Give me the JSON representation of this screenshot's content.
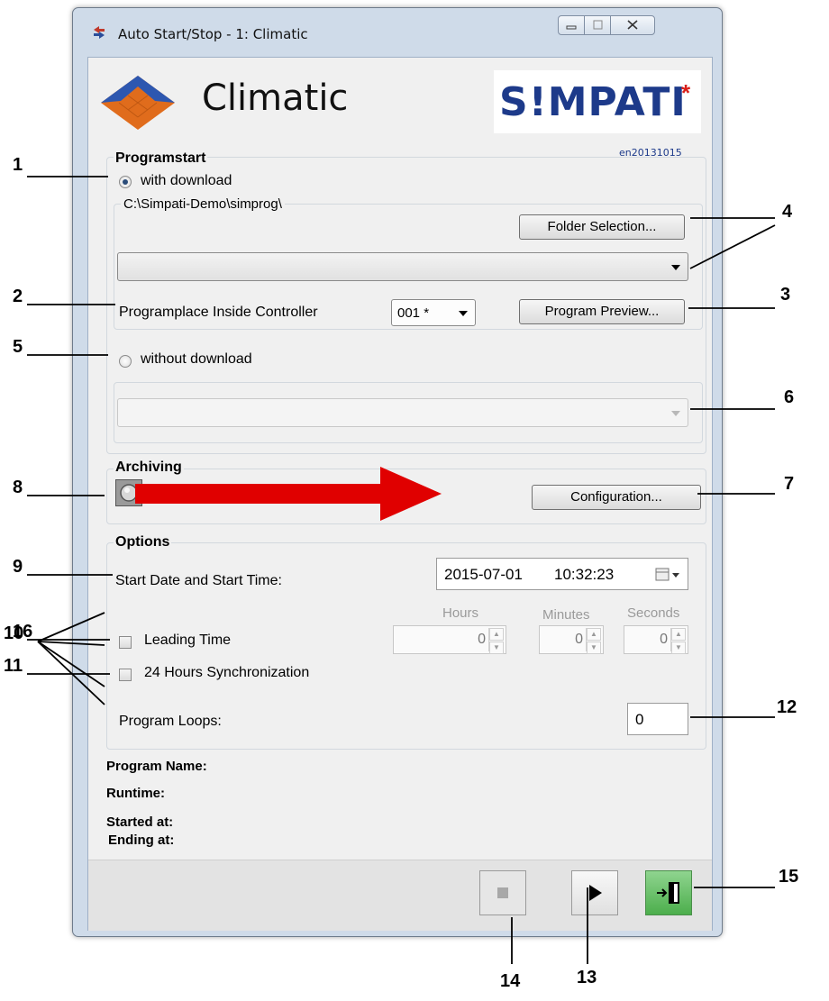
{
  "window": {
    "title": "Auto Start/Stop - 1: Climatic",
    "app_name": "Climatic",
    "logo_text": "S!MPATI",
    "logo_star": "*",
    "version": "en20131015"
  },
  "programstart": {
    "heading": "Programstart",
    "with_download_label": "with download",
    "with_download_selected": true,
    "path": "C:\\Simpati-Demo\\simprog\\",
    "folder_button": "Folder Selection...",
    "program_dropdown_value": "",
    "programplace_label": "Programplace Inside Controller",
    "programplace_value": "001 *",
    "preview_button": "Program Preview...",
    "without_download_label": "without download",
    "without_download_selected": false,
    "without_download_value": ""
  },
  "archiving": {
    "heading": "Archiving",
    "config_button": "Configuration..."
  },
  "options": {
    "heading": "Options",
    "start_label": "Start Date and Start Time:",
    "start_date": "2015-07-01",
    "start_time": "10:32:23",
    "hours_label": "Hours",
    "minutes_label": "Minutes",
    "seconds_label": "Seconds",
    "hours_value": "0",
    "minutes_value": "0",
    "seconds_value": "0",
    "leading_time_label": "Leading Time",
    "sync_label": "24 Hours Synchronization",
    "loops_label": "Program Loops:",
    "loops_value": "0"
  },
  "status": {
    "program_name_label": "Program Name:",
    "runtime_label": "Runtime:",
    "started_label": "Started at:",
    "ending_label": "Ending at:"
  },
  "callouts": {
    "c1": "1",
    "c2": "2",
    "c3": "3",
    "c4": "4",
    "c5": "5",
    "c6": "6",
    "c7": "7",
    "c8": "8",
    "c9": "9",
    "c10": "10",
    "c11": "11",
    "c12": "12",
    "c13": "13",
    "c14": "14",
    "c15": "15",
    "c16": "16"
  },
  "colors": {
    "accent": "#e00000",
    "logo_blue": "#1d3a8a",
    "logo_red": "#d91e18",
    "exit_green": "#5cb85c"
  }
}
